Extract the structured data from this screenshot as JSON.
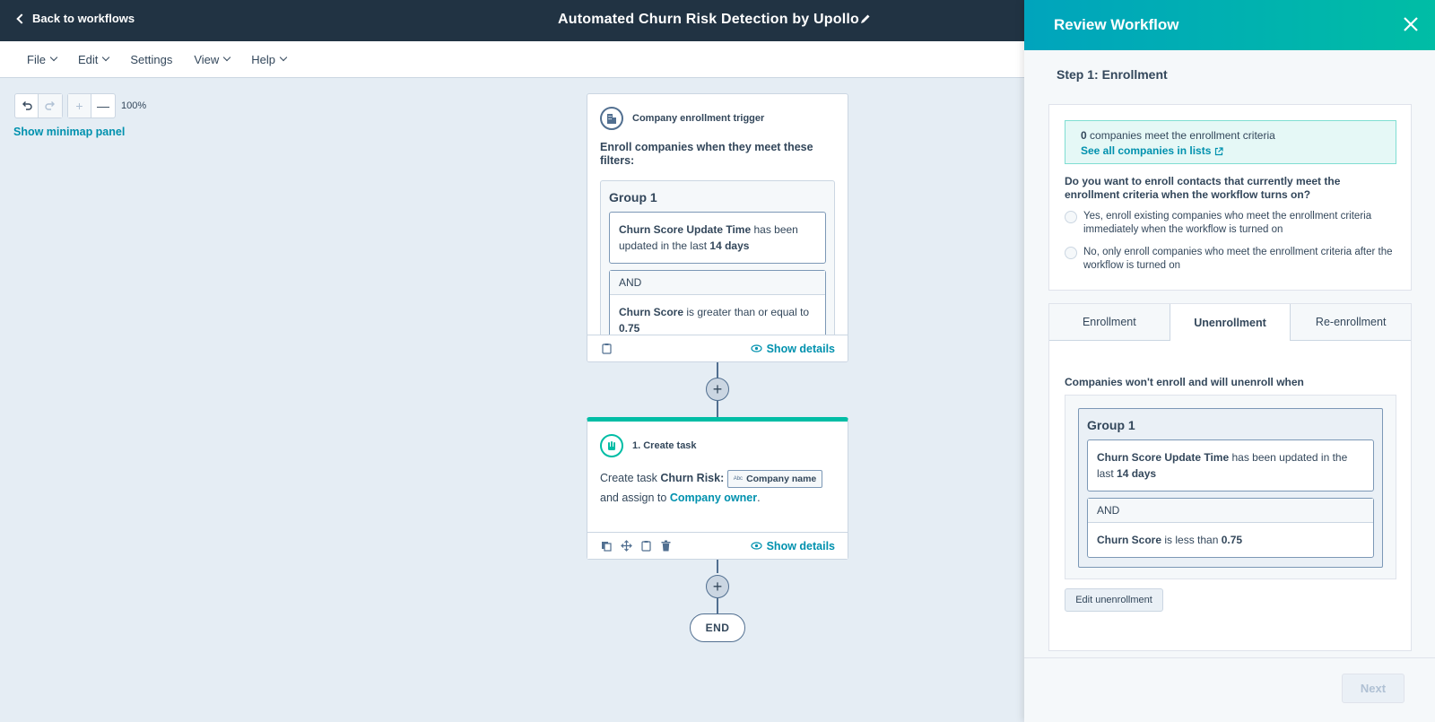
{
  "topbar": {
    "back_label": "Back to workflows",
    "workflow_title": "Automated Churn Risk Detection by Upollo"
  },
  "menu": {
    "items": [
      {
        "label": "File",
        "has_caret": true
      },
      {
        "label": "Edit",
        "has_caret": true
      },
      {
        "label": "Settings",
        "has_caret": false
      },
      {
        "label": "View",
        "has_caret": true
      },
      {
        "label": "Help",
        "has_caret": true
      }
    ]
  },
  "canvas": {
    "zoom": "100%",
    "minimap_link": "Show minimap panel"
  },
  "trigger_card": {
    "title": "Company enrollment trigger",
    "enroll_text": "Enroll companies when they meet these filters:",
    "group_title": "Group 1",
    "cond1_prop": "Churn Score Update Time",
    "cond1_mid": " has been updated in the last ",
    "cond1_val": "14 days",
    "and_label": "AND",
    "cond2_prop": "Churn Score",
    "cond2_mid": " is greater than or equal to ",
    "cond2_val": "0.75",
    "show_details": "Show details"
  },
  "task_card": {
    "title": "1. Create task",
    "prefix": "Create task ",
    "task_name": "Churn Risk:",
    "token_type": "Abc",
    "token_label": "Company name",
    "assign_prefix": "and assign to ",
    "assignee": "Company owner",
    "suffix": ".",
    "show_details": "Show details"
  },
  "end_label": "END",
  "panel": {
    "title": "Review Workflow",
    "step_title": "Step 1: Enrollment",
    "info_count": "0",
    "info_text": " companies meet the enrollment criteria",
    "info_link": "See all companies in lists",
    "question": "Do you want to enroll contacts that currently meet the enrollment criteria when the workflow turns on?",
    "option_yes": "Yes, enroll existing companies who meet the enrollment criteria immediately when the workflow is turned on",
    "option_no": "No, only enroll companies who meet the enrollment criteria after the workflow is turned on",
    "tabs": [
      "Enrollment",
      "Unenrollment",
      "Re-enrollment"
    ],
    "active_tab": "Unenrollment",
    "unenroll_title": "Companies won't enroll and will unenroll when",
    "group_title": "Group 1",
    "cond1_prop": "Churn Score Update Time",
    "cond1_mid": " has been updated in the last ",
    "cond1_val": "14 days",
    "and_label": "AND",
    "cond2_prop": "Churn Score",
    "cond2_mid": " is less than ",
    "cond2_val": "0.75",
    "edit_button": "Edit unenrollment",
    "next_button": "Next"
  },
  "colors": {
    "topbar": "#213343",
    "accent": "#0091ae",
    "teal": "#00bda5",
    "canvas": "#e5edf4"
  }
}
